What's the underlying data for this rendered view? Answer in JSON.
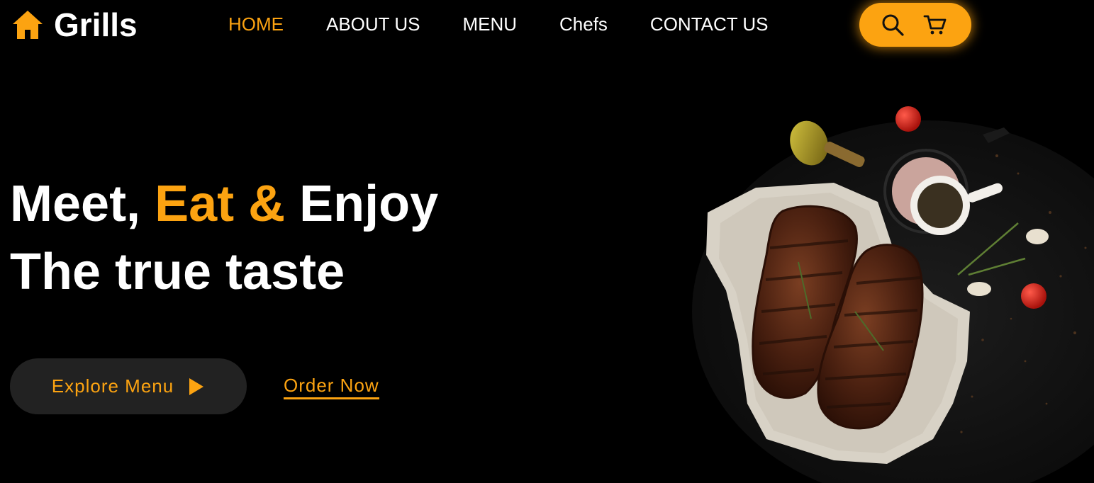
{
  "header": {
    "logo_text": "Grills",
    "logo_icon": "home-icon",
    "nav": [
      {
        "label": "HOME",
        "active": true
      },
      {
        "label": "ABOUT US",
        "active": false
      },
      {
        "label": "MENU",
        "active": false
      },
      {
        "label": "Chefs",
        "active": false
      },
      {
        "label": "CONTACT US",
        "active": false
      }
    ],
    "actions": {
      "search_icon": "search-icon",
      "cart_icon": "cart-icon"
    }
  },
  "hero": {
    "line1": {
      "word1": "Meet,",
      "word2": "Eat &",
      "word3": "Enjoy"
    },
    "line2": "The true taste",
    "explore_label": "Explore Menu",
    "explore_icon": "play-icon",
    "order_label": "Order Now"
  },
  "image": {
    "subject": "steak-plate-image"
  },
  "colors": {
    "accent": "#fca311",
    "background": "#000000",
    "button_dark": "#222222",
    "text": "#ffffff"
  }
}
